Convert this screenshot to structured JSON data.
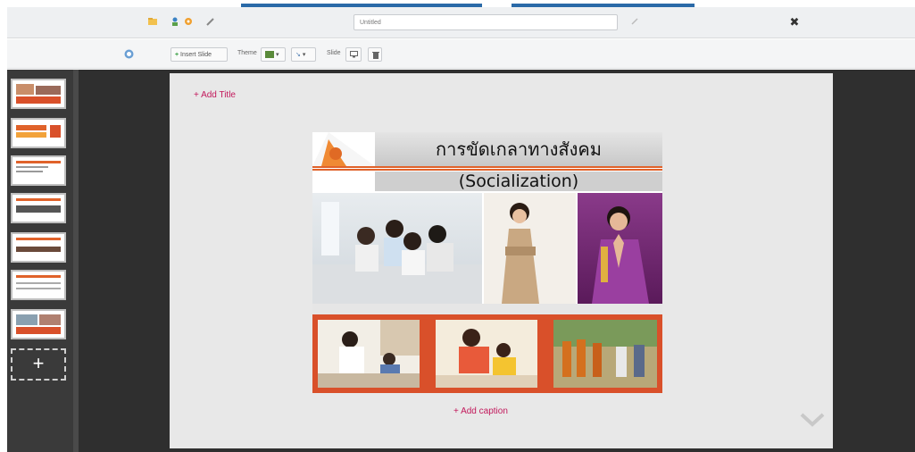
{
  "topbar": {
    "presentation_title": "Untitled",
    "icons": [
      "folder-icon",
      "share-icon",
      "settings-icon",
      "wrench-icon",
      "edit-icon",
      "close-icon"
    ],
    "close_glyph": "✖"
  },
  "toolbar": {
    "insert_slide_label": "Insert Slide",
    "theme_label": "Theme",
    "slide_label": "Slide",
    "icons": [
      "refresh-icon",
      "plus-icon",
      "theme-color-icon",
      "transition-icon",
      "monitor-icon",
      "trash-icon"
    ]
  },
  "sidebar": {
    "thumbnail_count": 7,
    "add_slide_glyph": "+"
  },
  "canvas": {
    "add_title_label": "+ Add Title",
    "add_caption_label": "+ Add caption"
  },
  "slide": {
    "title_thai": "การขัดเกลาทางสังคม",
    "subtitle": "(Socialization)",
    "colors": {
      "accent": "#e0622a",
      "band": "#d9502a",
      "logo_orange": "#f08a34"
    }
  }
}
